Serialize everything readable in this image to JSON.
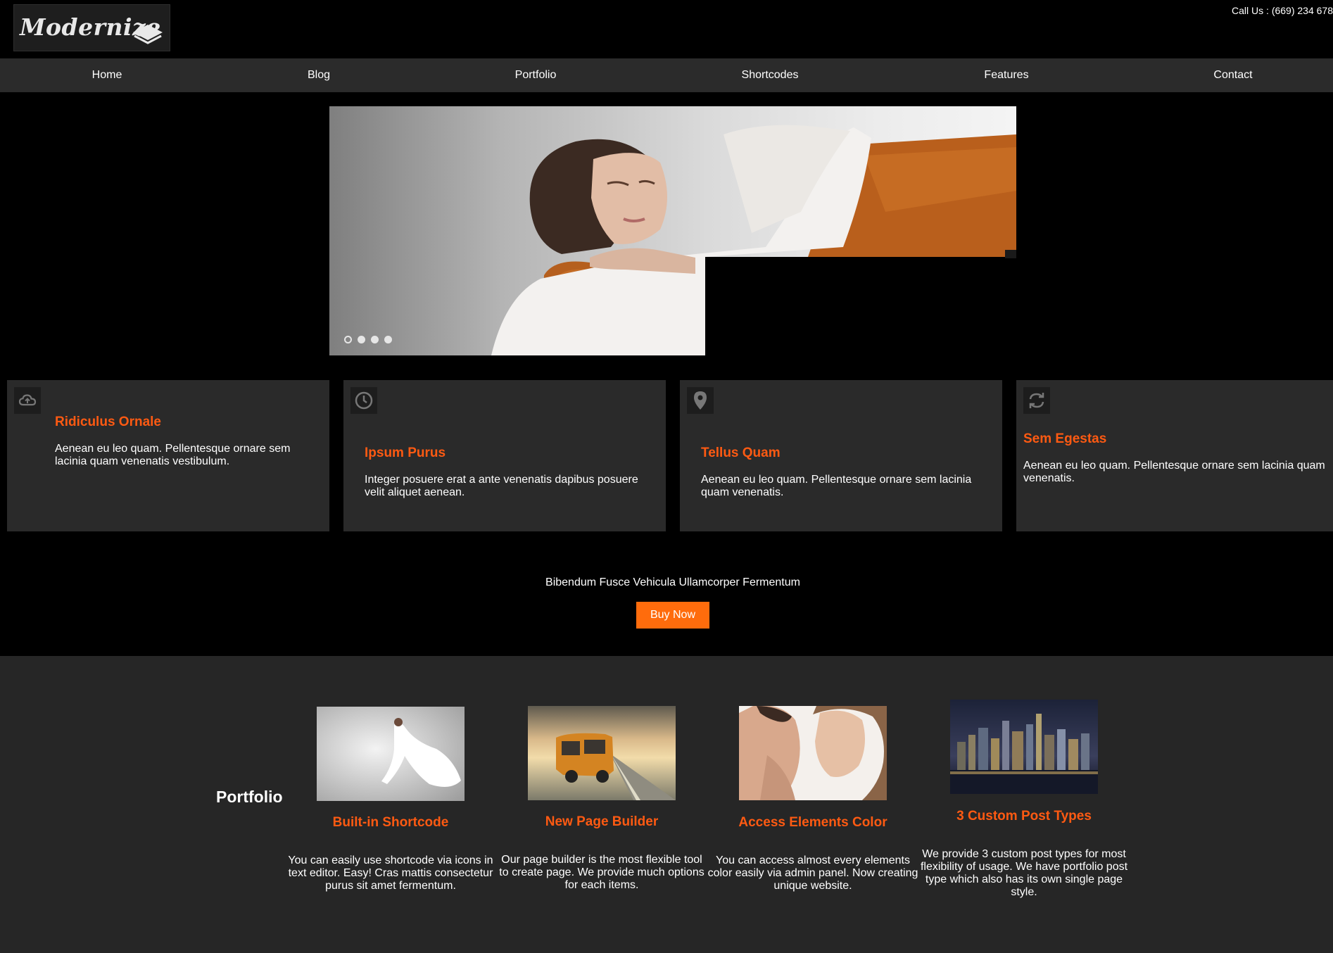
{
  "header": {
    "logo_text": "Modernize",
    "call_us": "Call Us : (669) 234 678"
  },
  "nav": {
    "items": [
      {
        "label": "Home"
      },
      {
        "label": "Blog"
      },
      {
        "label": "Portfolio"
      },
      {
        "label": "Shortcodes"
      },
      {
        "label": "Features"
      },
      {
        "label": "Contact"
      }
    ]
  },
  "slider": {
    "dots_count": 4,
    "active_index": 0
  },
  "features": [
    {
      "icon": "cloud-icon",
      "title": "Ridiculus Ornale",
      "text": "Aenean eu leo quam. Pellentesque ornare sem lacinia quam venenatis vestibulum."
    },
    {
      "icon": "clock-icon",
      "title": "Ipsum Purus",
      "text": "Integer posuere erat a ante venenatis dapibus posuere velit aliquet aenean."
    },
    {
      "icon": "map-pin-icon",
      "title": "Tellus Quam",
      "text": "Aenean eu leo quam. Pellentesque ornare sem lacinia quam venenatis."
    },
    {
      "icon": "refresh-icon",
      "title": "Sem Egestas",
      "text": "Aenean eu leo quam. Pellentesque ornare sem lacinia quam venenatis."
    }
  ],
  "cta": {
    "text": "Bibendum Fusce Vehicula Ullamcorper Fermentum",
    "button_label": "Buy Now"
  },
  "portfolio": {
    "heading": "Portfolio",
    "items": [
      {
        "title": "Built-in Shortcode",
        "text": "You can easily use shortcode via icons in text editor. Easy! Cras mattis consectetur purus sit amet fermentum."
      },
      {
        "title": "New Page Builder",
        "text": "Our page builder is the most flexible tool to create page. We provide much options for each items."
      },
      {
        "title": "Access Elements Color",
        "text": "You can access almost every elements color easily via admin panel. Now creating unique website."
      },
      {
        "title": "3 Custom Post Types",
        "text": "We provide 3 custom post types for most flexibility of usage. We have portfolio post type which also has its own single page style."
      }
    ]
  },
  "colors": {
    "accent": "#ff5a12",
    "button": "#ff6c0c",
    "nav_bg": "#2b2b2b",
    "panel_bg": "#2a2a2a",
    "section_bg": "#262626"
  }
}
